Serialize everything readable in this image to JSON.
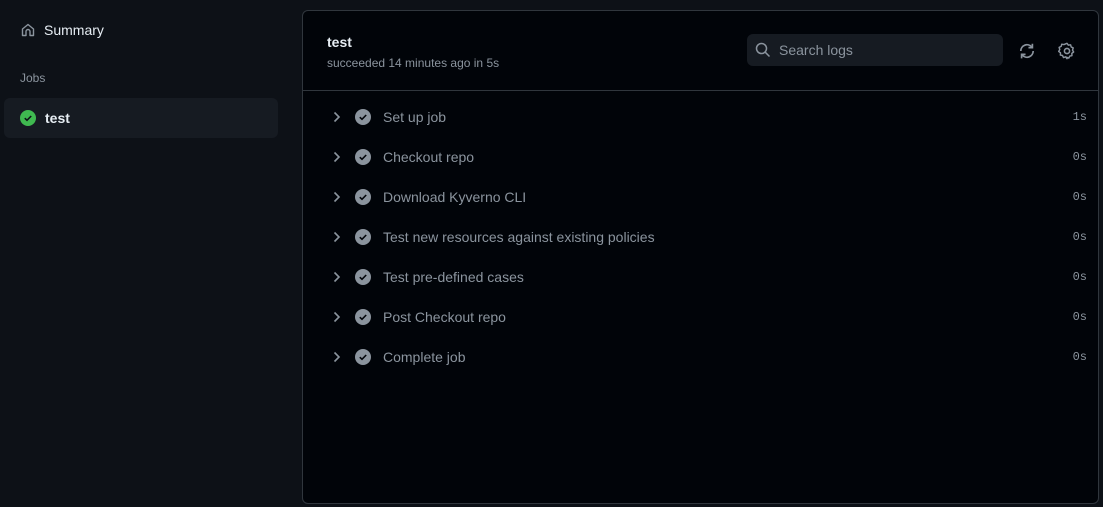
{
  "sidebar": {
    "summary_label": "Summary",
    "jobs_heading": "Jobs",
    "jobs": [
      {
        "name": "test",
        "status": "success"
      }
    ]
  },
  "job": {
    "title": "test",
    "subtitle": "succeeded 14 minutes ago in 5s",
    "search_placeholder": "Search logs"
  },
  "steps": [
    {
      "name": "Set up job",
      "duration": "1s"
    },
    {
      "name": "Checkout repo",
      "duration": "0s"
    },
    {
      "name": "Download Kyverno CLI",
      "duration": "0s"
    },
    {
      "name": "Test new resources against existing policies",
      "duration": "0s"
    },
    {
      "name": "Test pre-defined cases",
      "duration": "0s"
    },
    {
      "name": "Post Checkout repo",
      "duration": "0s"
    },
    {
      "name": "Complete job",
      "duration": "0s"
    }
  ],
  "colors": {
    "success": "#3fb950",
    "step_check": "#8b949e",
    "background": "#0d1117",
    "panel": "#010409"
  }
}
